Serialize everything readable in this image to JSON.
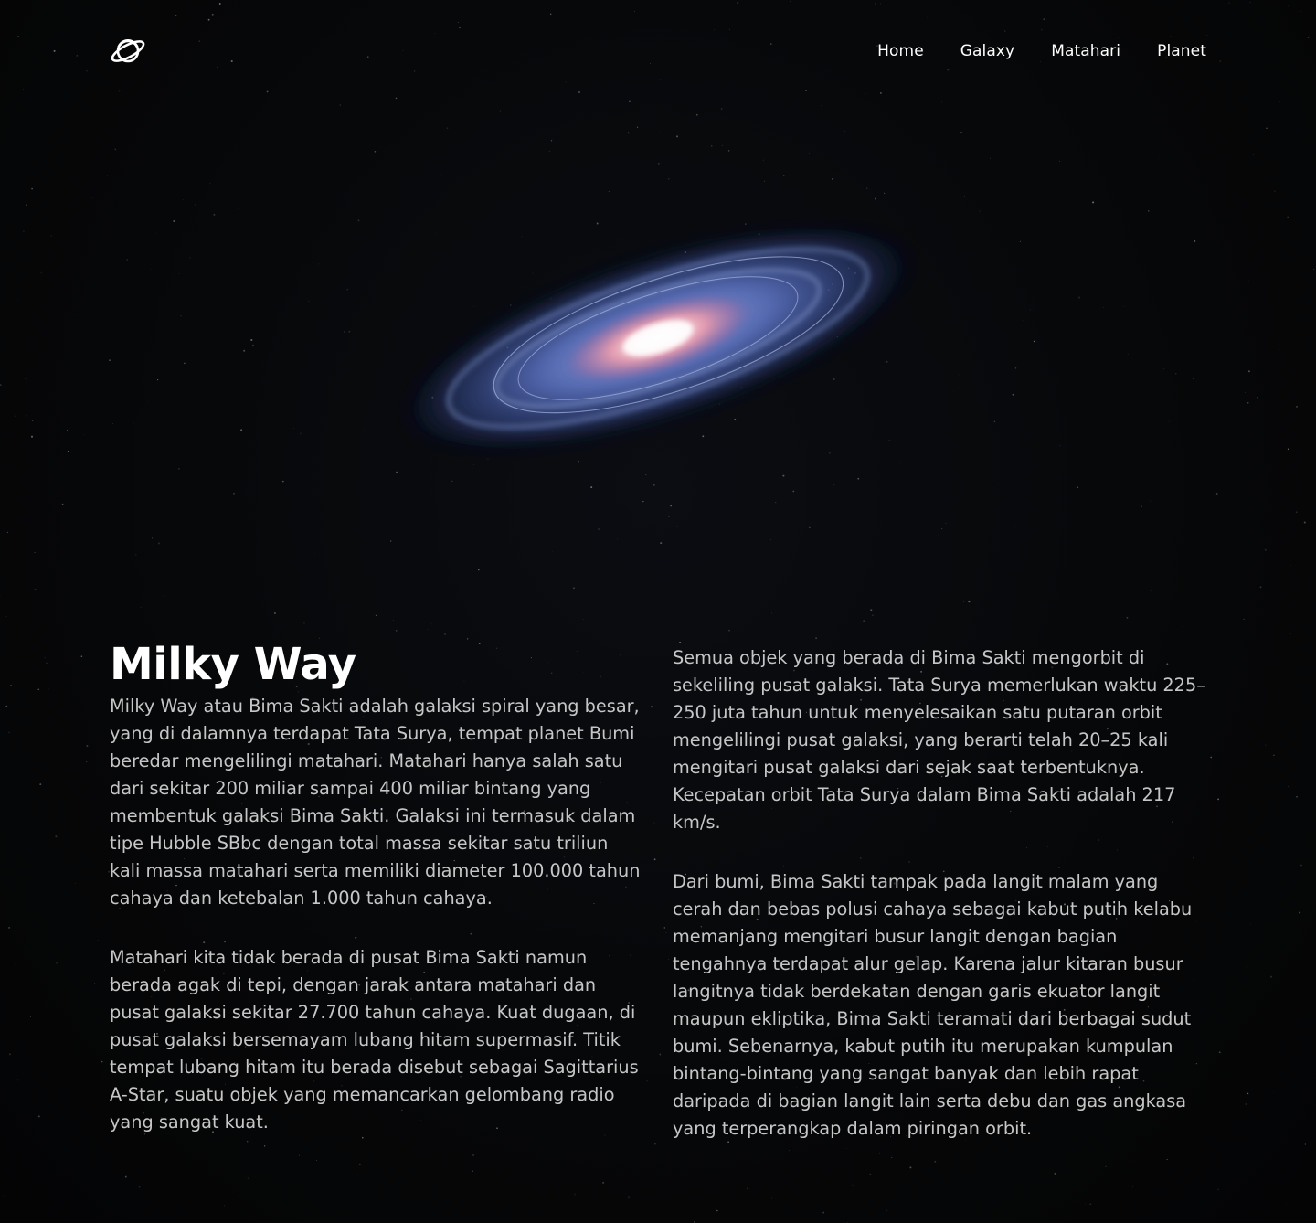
{
  "nav": {
    "logo_icon": "planet-icon",
    "items": [
      {
        "label": "Home"
      },
      {
        "label": "Galaxy"
      },
      {
        "label": "Matahari"
      },
      {
        "label": "Planet"
      }
    ]
  },
  "hero": {
    "image": "spiral-galaxy-illustration"
  },
  "article": {
    "title": "Milky Way",
    "left_paragraphs": [
      "Milky Way atau Bima Sakti adalah galaksi spiral yang besar, yang di dalamnya terdapat Tata Surya, tempat planet Bumi beredar mengelilingi matahari. Matahari hanya salah satu dari sekitar 200 miliar sampai 400 miliar bintang yang membentuk galaksi Bima Sakti. Galaksi ini termasuk dalam tipe Hubble SBbc dengan total massa sekitar satu triliun kali massa matahari serta memiliki diameter 100.000 tahun cahaya dan ketebalan 1.000 tahun cahaya.",
      "Matahari kita tidak berada di pusat Bima Sakti namun berada agak di tepi, dengan jarak antara matahari dan pusat galaksi sekitar 27.700 tahun cahaya. Kuat dugaan, di pusat galaksi bersemayam lubang hitam supermasif. Titik tempat lubang hitam itu berada disebut sebagai Sagittarius A-Star, suatu objek yang memancarkan gelombang radio yang sangat kuat."
    ],
    "right_paragraphs": [
      "Semua objek yang berada di Bima Sakti mengorbit di sekeliling pusat galaksi. Tata Surya memerlukan waktu 225–250 juta tahun untuk menyelesaikan satu putaran orbit mengelilingi pusat galaksi, yang berarti telah 20–25 kali mengitari pusat galaksi dari sejak saat terbentuknya. Kecepatan orbit Tata Surya dalam Bima Sakti adalah 217 km/s.",
      "Dari bumi, Bima Sakti tampak pada langit malam yang cerah dan bebas polusi cahaya sebagai kabut putih kelabu memanjang mengitari busur langit dengan bagian tengahnya terdapat alur gelap. Karena jalur kitaran busur langitnya tidak berdekatan dengan garis ekuator langit maupun ekliptika, Bima Sakti teramati dari berbagai sudut bumi. Sebenarnya, kabut putih itu merupakan kumpulan bintang-bintang yang sangat banyak dan lebih rapat daripada di bagian langit lain serta debu dan gas angkasa yang terperangkap dalam piringan orbit."
    ]
  },
  "colors": {
    "background": "#050607",
    "heading": "#ffffff",
    "body_text": "#c6c6c6",
    "nav_text": "#ffffff"
  }
}
